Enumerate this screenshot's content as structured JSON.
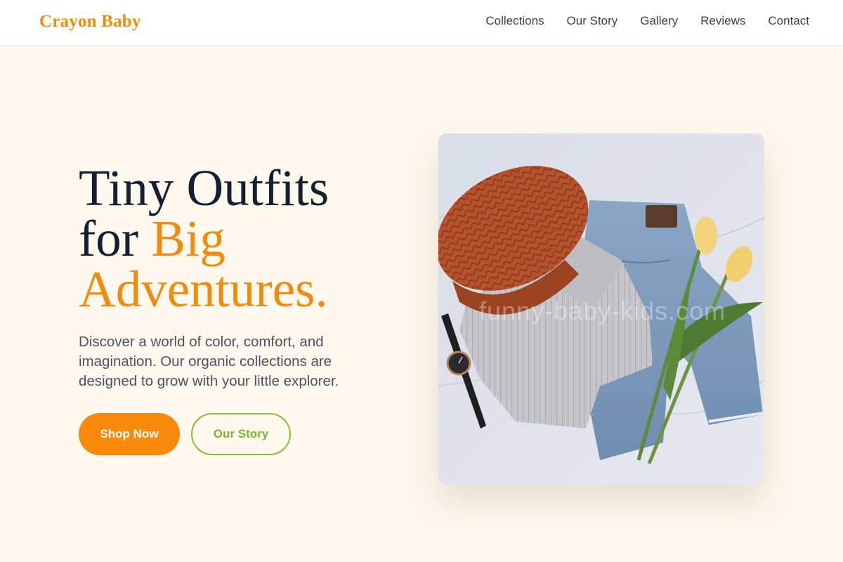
{
  "header": {
    "brand": "Crayon Baby",
    "nav": [
      {
        "label": "Collections"
      },
      {
        "label": "Our Story"
      },
      {
        "label": "Gallery"
      },
      {
        "label": "Reviews"
      },
      {
        "label": "Contact"
      }
    ]
  },
  "hero": {
    "title_line1": "Tiny Outfits",
    "title_for": "for ",
    "title_big": "Big",
    "title_adventures": "Adventures.",
    "description": "Discover a world of color, comfort, and imagination. Our organic collections are designed to grow with your little explorer.",
    "primary_button": "Shop Now",
    "secondary_button": "Our Story",
    "image_watermark": "funny-baby-kids.com"
  },
  "colors": {
    "accent": "#f28b0c",
    "green": "#86bd33",
    "background": "#fdf9ef",
    "heading": "#161e31"
  }
}
